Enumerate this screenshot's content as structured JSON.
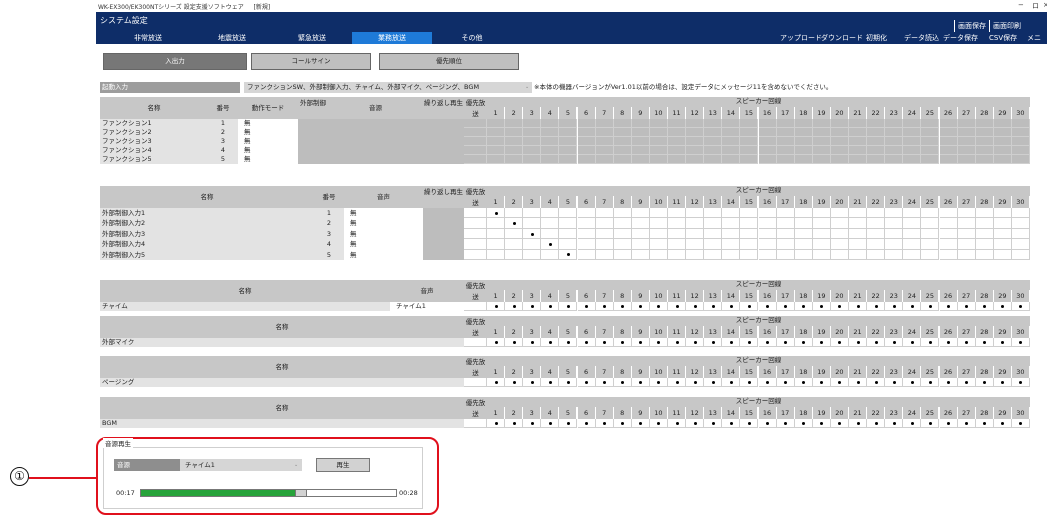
{
  "titlebar": {
    "text": "WK-EX300/EK300NTシリーズ 設定支援ソフトウェア 　 [新規]",
    "min": "−",
    "max": "ロ",
    "close": "×"
  },
  "app": {
    "title": "システム設定",
    "tabs": [
      {
        "label": "非常放送",
        "color": "#e01a2a"
      },
      {
        "label": "地震放送",
        "color": "#1a4fd6"
      },
      {
        "label": "緊急放送",
        "color": "#e8d017"
      },
      {
        "label": "業務放送",
        "color": "#ffffff"
      },
      {
        "label": "その他",
        "color": "#ffffff"
      }
    ],
    "top_buttons": [
      "画面保存",
      "画面印刷"
    ],
    "buttons": [
      "アップロード",
      "ダウンロード",
      "初期化",
      "データ読込",
      "データ保存",
      "CSV保存",
      "メニ"
    ]
  },
  "subtabs": [
    "入出力",
    "コールサイン",
    "優先順位"
  ],
  "start": {
    "label": "起動入力",
    "value": "ファンクションSW、外部制御入力、チャイム、外部マイク、ページング、BGM",
    "note": "※本体の機器バージョンがVer1.01以前の場合は、設定データにメッセージ11を含めないでください。"
  },
  "speaker_label": "スピーカー回線",
  "speaker_nums": [
    "1",
    "2",
    "3",
    "4",
    "5",
    "6",
    "7",
    "8",
    "9",
    "10",
    "11",
    "12",
    "13",
    "14",
    "15",
    "16",
    "17",
    "18",
    "19",
    "20",
    "21",
    "22",
    "23",
    "24",
    "25",
    "26",
    "27",
    "28",
    "29",
    "30"
  ],
  "priority_label": "優先放送",
  "t1": {
    "headers": {
      "name": "名称",
      "num": "番号",
      "mode": "動作モード",
      "ext": "外部制御",
      "src": "音源",
      "rep": "繰り返し再生"
    },
    "rows": [
      {
        "name": "ファンクション1",
        "num": "1",
        "mode": "無"
      },
      {
        "name": "ファンクション2",
        "num": "2",
        "mode": "無"
      },
      {
        "name": "ファンクション3",
        "num": "3",
        "mode": "無"
      },
      {
        "name": "ファンクション4",
        "num": "4",
        "mode": "無"
      },
      {
        "name": "ファンクション5",
        "num": "5",
        "mode": "無"
      }
    ]
  },
  "t2": {
    "headers": {
      "name": "名称",
      "num": "番号",
      "voice": "音声",
      "rep": "繰り返し再生"
    },
    "rows": [
      {
        "name": "外部制御入力1",
        "num": "1",
        "voice": "無",
        "dot": 1
      },
      {
        "name": "外部制御入力2",
        "num": "2",
        "voice": "無",
        "dot": 2
      },
      {
        "name": "外部制御入力3",
        "num": "3",
        "voice": "無",
        "dot": 3
      },
      {
        "name": "外部制御入力4",
        "num": "4",
        "voice": "無",
        "dot": 4
      },
      {
        "name": "外部制御入力5",
        "num": "5",
        "voice": "無",
        "dot": 5
      }
    ]
  },
  "t3": {
    "headers": {
      "name": "名称",
      "voice": "音声"
    },
    "row": {
      "name": "チャイム",
      "voice": "チャイム1"
    }
  },
  "t4": {
    "headers": {
      "name": "名称"
    },
    "row": {
      "name": "外部マイク"
    }
  },
  "t5": {
    "headers": {
      "name": "名称"
    },
    "row": {
      "name": "ページング"
    }
  },
  "t6": {
    "headers": {
      "name": "名称"
    },
    "row": {
      "name": "BGM"
    }
  },
  "player": {
    "title": "音源再生",
    "src_label": "音源",
    "src_value": "チャイム1",
    "play": "再生",
    "t_start": "00:17",
    "t_end": "00:28",
    "progress": 0.61
  },
  "callout": "①"
}
